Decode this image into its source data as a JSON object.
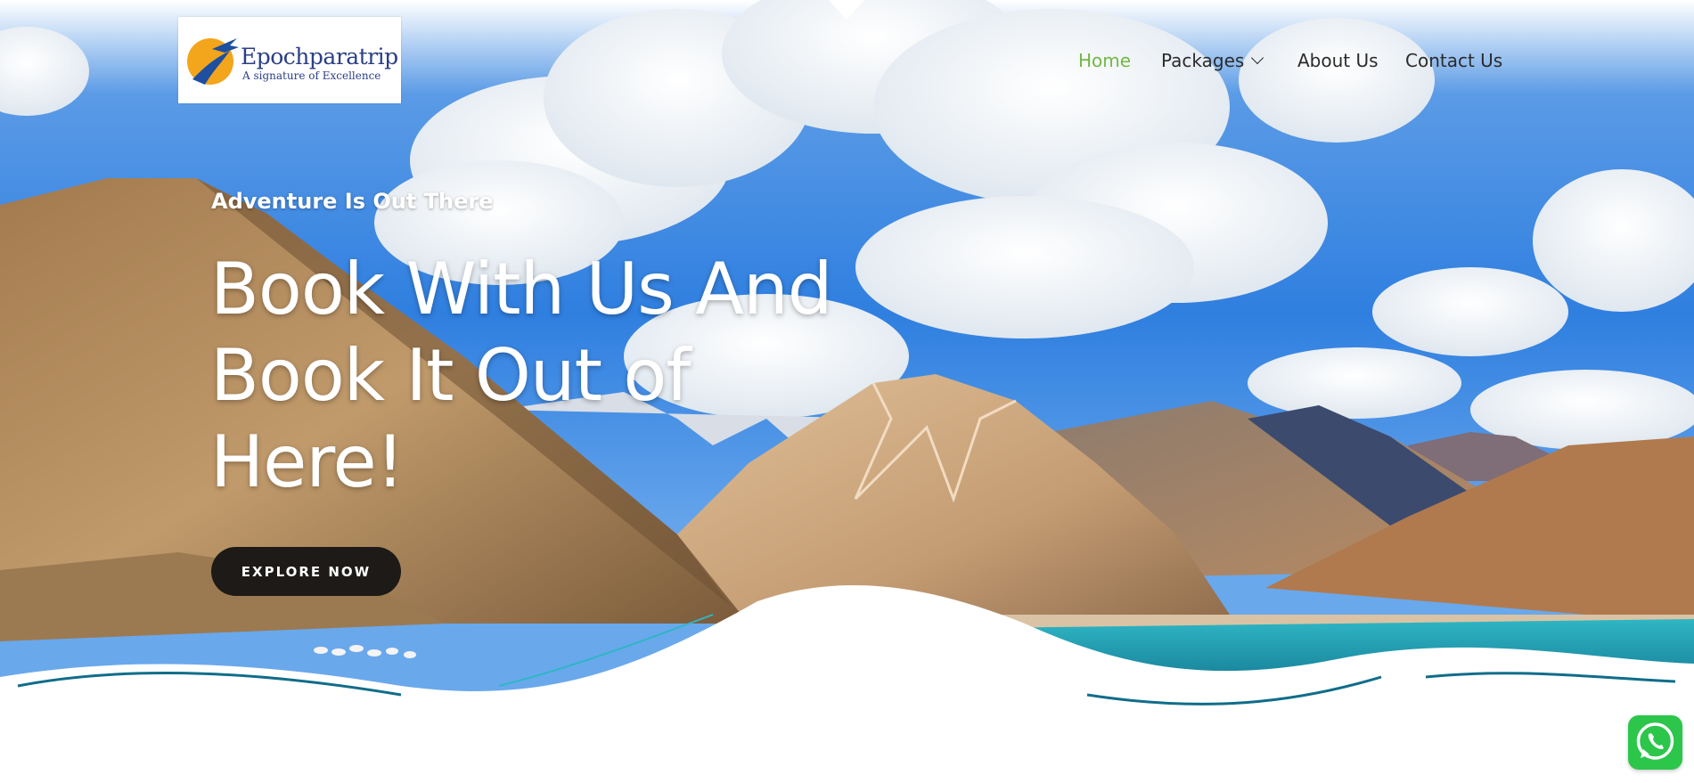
{
  "brand": {
    "name": "Epochparatrip",
    "tagline": "A signature of Excellence",
    "logo_icon": "airplane-sun-logo"
  },
  "nav": {
    "items": [
      {
        "label": "Home",
        "active": true
      },
      {
        "label": "Packages",
        "has_dropdown": true
      },
      {
        "label": "About Us"
      },
      {
        "label": "Contact Us"
      }
    ],
    "active_color": "#71b845"
  },
  "hero": {
    "subtitle": "Adventure Is Out There",
    "headline_lines": [
      "Book With Us And",
      "Book It Out of",
      "Here!"
    ],
    "cta_label": "EXPLORE NOW",
    "scene": "mountain-lake-sky-clouds"
  },
  "floating": {
    "whatsapp_icon": "whatsapp-icon",
    "whatsapp_color": "#2cc64b"
  }
}
